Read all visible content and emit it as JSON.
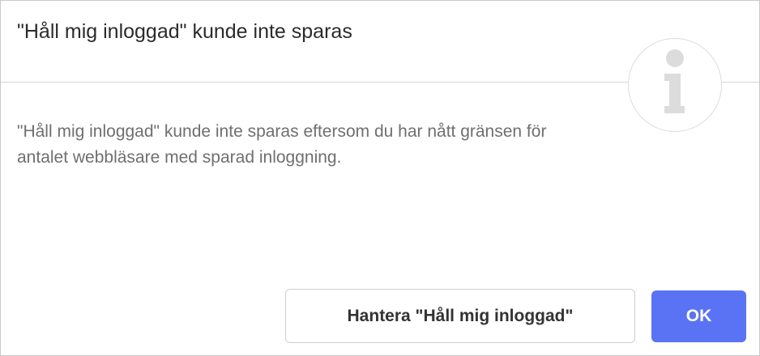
{
  "dialog": {
    "title": "\"Håll mig inloggad\" kunde inte sparas",
    "icon": "info-icon",
    "message": "\"Håll mig inloggad\" kunde inte sparas eftersom du har nått gränsen för antalet webbläsare med sparad inloggning.",
    "buttons": {
      "manage_label": "Hantera \"Håll mig inloggad\"",
      "ok_label": "OK"
    }
  },
  "colors": {
    "primary_button": "#5a73f5",
    "icon_gray": "#dcdcdc",
    "title_text": "#2b2b2b",
    "message_text": "#6f6f6f"
  }
}
